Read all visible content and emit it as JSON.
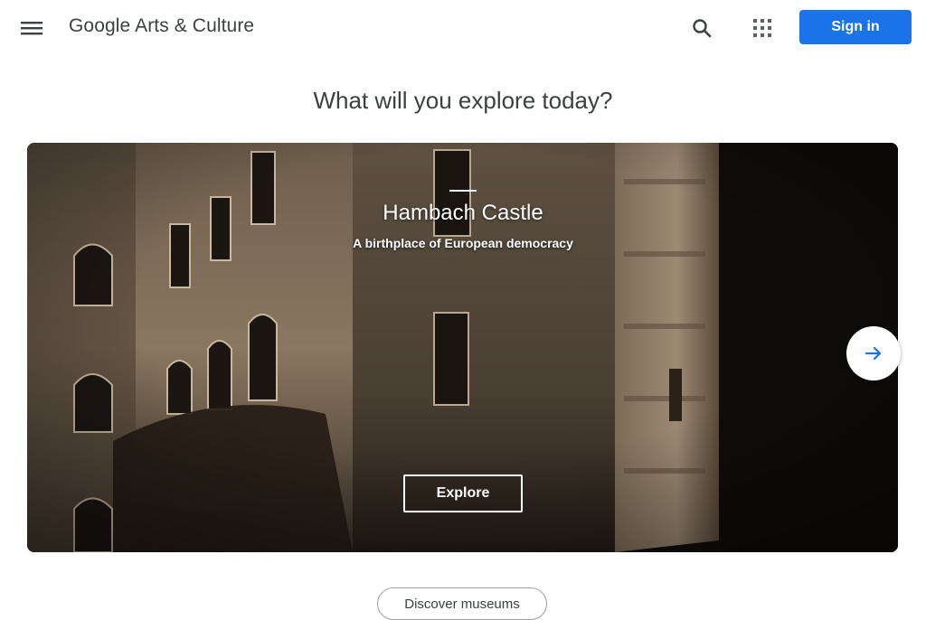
{
  "header": {
    "logo_text": "Google Arts & Culture",
    "menu_icon": "hamburger-menu-icon",
    "search_icon": "search-icon",
    "apps_icon": "apps-grid-icon",
    "signin_label": "Sign in"
  },
  "main": {
    "headline": "What will you explore today?"
  },
  "hero": {
    "title": "Hambach Castle",
    "subtitle": "A birthplace of European democracy",
    "explore_label": "Explore",
    "next_icon": "arrow-right-icon"
  },
  "footer": {
    "discover_label": "Discover museums"
  },
  "colors": {
    "accent": "#1a73e8",
    "text": "#3c4043",
    "hero_bg": "#1a1613"
  }
}
